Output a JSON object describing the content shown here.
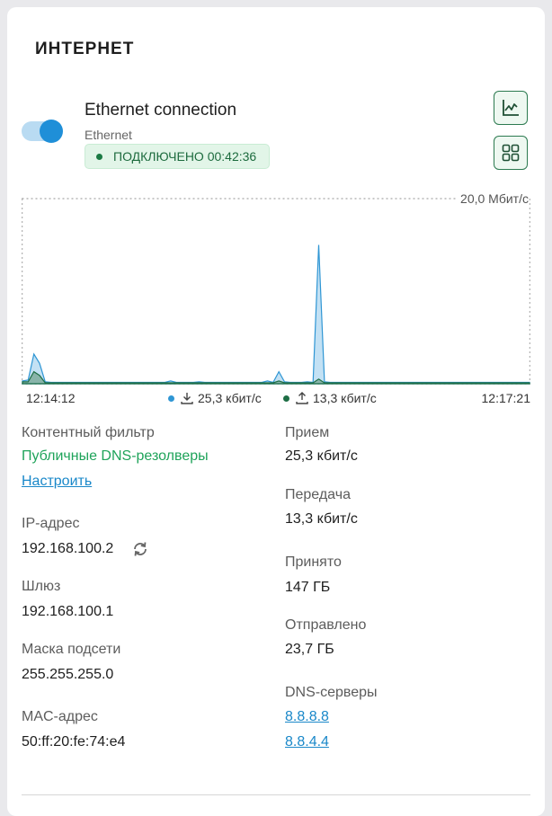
{
  "section": {
    "title": "ИНТЕРНЕТ"
  },
  "connection": {
    "name": "Ethernet connection",
    "type": "Ethernet",
    "enabled": true,
    "status": "ПОДКЛЮЧЕНО 00:42:36"
  },
  "colors": {
    "receive": "#2f96d4",
    "transmit": "#1e6e45",
    "accent_green": "#1fa35a",
    "link": "#1a88c9"
  },
  "chart": {
    "max_label": "20,0 Мбит/с",
    "start_time": "12:14:12",
    "end_time": "12:17:21",
    "rx_legend": "25,3 кбит/с",
    "tx_legend": "13,3 кбит/с"
  },
  "chart_data": {
    "type": "area",
    "ylim": [
      0,
      20
    ],
    "y_unit": "Мбит/с",
    "series": [
      {
        "values": [
          0.3,
          0.4,
          3.2,
          2.2,
          0.2,
          0.15,
          0.15,
          0.15,
          0.15,
          0.15,
          0.15,
          0.15,
          0.15,
          0.15,
          0.15,
          0.15,
          0.15,
          0.15,
          0.15,
          0.15,
          0.15,
          0.15,
          0.15,
          0.15,
          0.15,
          0.15,
          0.3,
          0.15,
          0.15,
          0.15,
          0.15,
          0.2,
          0.15,
          0.15,
          0.15,
          0.15,
          0.15,
          0.15,
          0.15,
          0.15,
          0.15,
          0.15,
          0.15,
          0.3,
          0.15,
          1.3,
          0.2,
          0.15,
          0.15,
          0.15,
          0.2,
          0.15,
          15.0,
          0.2,
          0.15,
          0.15,
          0.15,
          0.15,
          0.15,
          0.15,
          0.15,
          0.15,
          0.15,
          0.15,
          0.15,
          0.15,
          0.15,
          0.15,
          0.15,
          0.15,
          0.15,
          0.15,
          0.15,
          0.15,
          0.15,
          0.15,
          0.15,
          0.15,
          0.15,
          0.15,
          0.15,
          0.15,
          0.15,
          0.15,
          0.15,
          0.15,
          0.15,
          0.15,
          0.15,
          0.15
        ]
      },
      {
        "values": [
          0.2,
          0.2,
          1.3,
          0.9,
          0.1,
          0.1,
          0.1,
          0.1,
          0.1,
          0.1,
          0.1,
          0.1,
          0.1,
          0.1,
          0.1,
          0.1,
          0.1,
          0.1,
          0.1,
          0.1,
          0.1,
          0.1,
          0.1,
          0.1,
          0.1,
          0.1,
          0.1,
          0.1,
          0.1,
          0.1,
          0.1,
          0.1,
          0.1,
          0.1,
          0.1,
          0.1,
          0.1,
          0.1,
          0.1,
          0.1,
          0.1,
          0.1,
          0.1,
          0.1,
          0.1,
          0.3,
          0.1,
          0.1,
          0.1,
          0.1,
          0.1,
          0.1,
          0.5,
          0.1,
          0.1,
          0.1,
          0.1,
          0.1,
          0.1,
          0.1,
          0.1,
          0.1,
          0.1,
          0.1,
          0.1,
          0.1,
          0.1,
          0.1,
          0.1,
          0.1,
          0.1,
          0.1,
          0.1,
          0.1,
          0.1,
          0.1,
          0.1,
          0.1,
          0.1,
          0.1,
          0.1,
          0.1,
          0.1,
          0.1,
          0.1,
          0.1,
          0.1,
          0.1,
          0.1,
          0.1
        ]
      }
    ]
  },
  "details_left": {
    "content_filter_label": "Контентный фильтр",
    "content_filter_value": "Публичные DNS-резолверы",
    "configure_link": "Настроить",
    "ip_label": "IP-адрес",
    "ip_value": "192.168.100.2",
    "gateway_label": "Шлюз",
    "gateway_value": "192.168.100.1",
    "mask_label": "Маска подсети",
    "mask_value": "255.255.255.0",
    "mac_label": "MAC-адрес",
    "mac_value": "50:ff:20:fe:74:e4"
  },
  "details_right": {
    "rx_label": "Прием",
    "rx_value": "25,3 кбит/с",
    "tx_label": "Передача",
    "tx_value": "13,3 кбит/с",
    "received_label": "Принято",
    "received_value": "147 ГБ",
    "sent_label": "Отправлено",
    "sent_value": "23,7 ГБ",
    "dns_label": "DNS-серверы",
    "dns_servers": [
      "8.8.8.8",
      "8.8.4.4"
    ]
  }
}
